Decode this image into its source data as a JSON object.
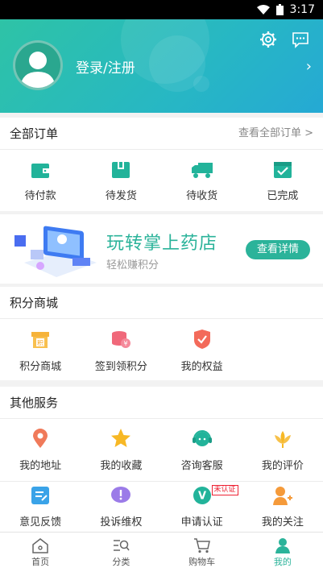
{
  "status": {
    "time": "3:17"
  },
  "profile": {
    "login_label": "登录/注册"
  },
  "orders": {
    "title": "全部订单",
    "link": "查看全部订单 >",
    "items": [
      {
        "label": "待付款",
        "icon": "wallet-icon"
      },
      {
        "label": "待发货",
        "icon": "package-icon"
      },
      {
        "label": "待收货",
        "icon": "truck-icon"
      },
      {
        "label": "已完成",
        "icon": "check-icon"
      }
    ]
  },
  "banner": {
    "title": "玩转掌上药店",
    "subtitle": "轻松赚积分",
    "button": "查看详情"
  },
  "points": {
    "title": "积分商城",
    "items": [
      {
        "label": "积分商城",
        "icon": "points-shop-icon"
      },
      {
        "label": "签到领积分",
        "icon": "coin-stack-icon"
      },
      {
        "label": "我的权益",
        "icon": "medal-icon"
      }
    ]
  },
  "services": {
    "title": "其他服务",
    "items": [
      {
        "label": "我的地址",
        "icon": "location-pin-icon"
      },
      {
        "label": "我的收藏",
        "icon": "star-icon"
      },
      {
        "label": "咨询客服",
        "icon": "headset-icon"
      },
      {
        "label": "我的评价",
        "icon": "lotus-icon"
      },
      {
        "label": "意见反馈",
        "icon": "edit-note-icon"
      },
      {
        "label": "投诉维权",
        "icon": "exclamation-bubble-icon"
      },
      {
        "label": "申请认证",
        "icon": "verify-v-icon",
        "badge": "未认证"
      },
      {
        "label": "我的关注",
        "icon": "follow-user-icon"
      }
    ]
  },
  "tabs": [
    {
      "label": "首页",
      "icon": "home-icon"
    },
    {
      "label": "分类",
      "icon": "category-search-icon"
    },
    {
      "label": "购物车",
      "icon": "cart-icon"
    },
    {
      "label": "我的",
      "icon": "user-icon"
    }
  ],
  "colors": {
    "brand": "#2bb39a",
    "header_start": "#2ec3a6",
    "header_end": "#25a9d4"
  }
}
